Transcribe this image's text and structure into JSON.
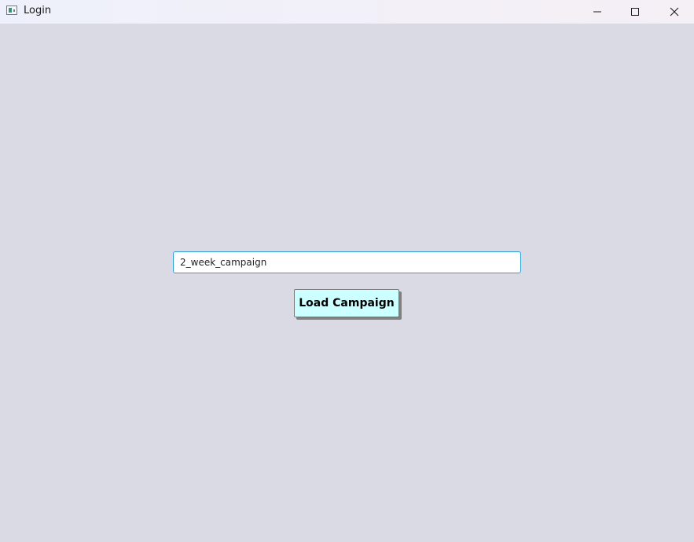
{
  "window": {
    "title": "Login",
    "controls": {
      "minimize_icon": "minimize-icon",
      "maximize_icon": "maximize-icon",
      "close_icon": "close-icon"
    }
  },
  "form": {
    "campaign_input_value": "2_week_campaign",
    "load_button_label": "Load Campaign"
  },
  "colors": {
    "background": "#dadae5",
    "input_border": "#2fa0d6",
    "button_bg": "#ccffff"
  }
}
